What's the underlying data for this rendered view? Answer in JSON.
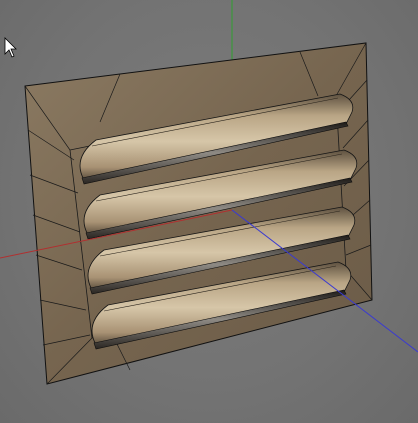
{
  "viewport": {
    "background": "#767676",
    "axis_colors": {
      "x": "#b03030",
      "y": "#2fa02f",
      "z": "#3a3ad0"
    }
  },
  "model": {
    "name_icon": "vent-grille-mesh",
    "slat_count": 4,
    "texture_colors": {
      "frame": "#7a6a55",
      "slat_light": "#cdbb9c",
      "slot_dark": "#2a2622",
      "edge": "#111111"
    }
  },
  "cursor": {
    "icon": "arrow-cursor-icon"
  }
}
